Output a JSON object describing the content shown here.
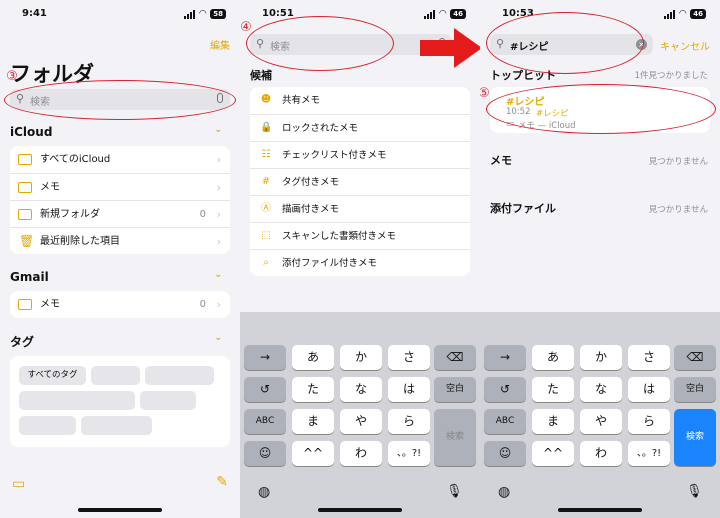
{
  "p1": {
    "time": "9:41",
    "battery": "58",
    "edit": "編集",
    "title": "フォルダ",
    "search_ph": "検索",
    "marker": "③",
    "icloud": "iCloud",
    "icloud_rows": [
      {
        "label": "すべてのiCloud",
        "count": ""
      },
      {
        "label": "メモ",
        "count": ""
      },
      {
        "label": "新規フォルダ",
        "count": "0"
      },
      {
        "label": "最近削除した項目",
        "count": ""
      }
    ],
    "gmail": "Gmail",
    "gmail_rows": [
      {
        "label": "メモ",
        "count": "0"
      }
    ],
    "tags": "タグ",
    "all_tags": "すべてのタグ"
  },
  "p2": {
    "time": "10:51",
    "battery": "46",
    "search_ph": "検索",
    "marker": "④",
    "cand": "候補",
    "items": [
      {
        "icon": "share-icon",
        "glyph": "☻",
        "label": "共有メモ"
      },
      {
        "icon": "lock-icon",
        "glyph": "🔒",
        "label": "ロックされたメモ"
      },
      {
        "icon": "checklist-icon",
        "glyph": "☷",
        "label": "チェックリスト付きメモ"
      },
      {
        "icon": "hash-icon",
        "glyph": "#",
        "label": "タグ付きメモ"
      },
      {
        "icon": "pen-icon",
        "glyph": "Ⓐ",
        "label": "描画付きメモ"
      },
      {
        "icon": "scan-icon",
        "glyph": "⬚",
        "label": "スキャンした書類付きメモ"
      },
      {
        "icon": "paperclip-icon",
        "glyph": "⌕",
        "label": "添付ファイル付きメモ"
      }
    ]
  },
  "p3": {
    "time": "10:53",
    "battery": "46",
    "query": "#レシピ",
    "cancel": "キャンセル",
    "marker": "⑤",
    "top_hit": "トップヒット",
    "top_hit_count": "1件見つかりました",
    "result": {
      "title": "#レシピ",
      "time": "10:52",
      "tag": "#レシピ",
      "folder": "メモ — iCloud"
    },
    "memo": "メモ",
    "memo_none": "見つかりません",
    "attach": "添付ファイル",
    "attach_none": "見つかりません"
  },
  "kb": {
    "r1": [
      "→",
      "あ",
      "か",
      "さ"
    ],
    "r2": [
      "↺",
      "た",
      "な",
      "は"
    ],
    "r3": [
      "ABC",
      "ま",
      "や",
      "ら"
    ],
    "r4": [
      "☺",
      "^^",
      "わ",
      "、。?!"
    ],
    "space": "空白",
    "search": "検索"
  }
}
